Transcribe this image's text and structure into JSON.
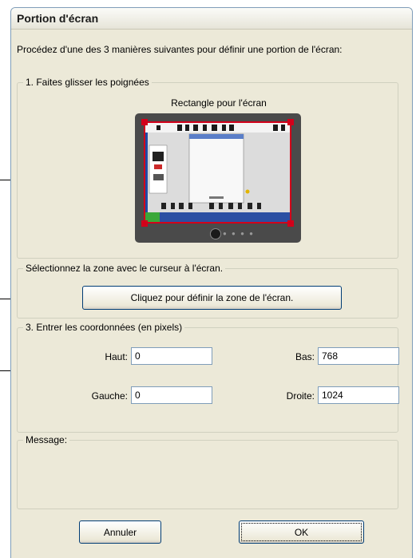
{
  "dialog": {
    "title": "Portion d'écran",
    "intro": "Procédez d'une des 3 manières suivantes pour définir une portion de l'écran:"
  },
  "group1": {
    "legend": "1. Faites glisser les poignées",
    "preview_label": "Rectangle pour l'écran"
  },
  "group2": {
    "legend": "Sélectionnez la zone avec le curseur à l'écran.",
    "button_label": "Cliquez pour définir la zone de l'écran."
  },
  "group3": {
    "legend": "3. Entrer les coordonnées (en pixels)",
    "haut_label": "Haut:",
    "haut_value": "0",
    "bas_label": "Bas:",
    "bas_value": "768",
    "gauche_label": "Gauche:",
    "gauche_value": "0",
    "droite_label": "Droite:",
    "droite_value": "1024"
  },
  "message_group": {
    "legend": "Message:"
  },
  "footer": {
    "cancel_label": "Annuler",
    "ok_label": "OK"
  },
  "colors": {
    "dialog_bg": "#ece9d8",
    "frame_border": "#7f9db9",
    "selection_red": "#d2001a",
    "button_border": "#003c74"
  }
}
